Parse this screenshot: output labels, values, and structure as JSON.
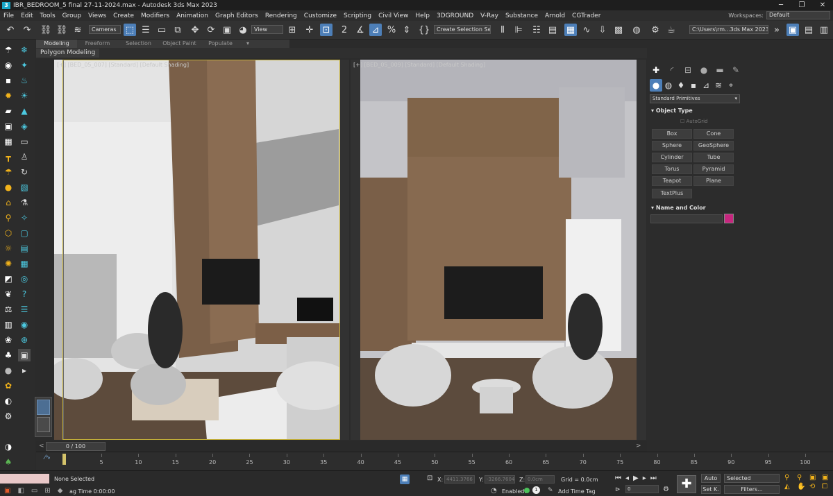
{
  "window": {
    "title": "IBR_BEDROOM_5 final 27-11-2024.max - Autodesk 3ds Max 2023",
    "controls": [
      "─",
      "❐",
      "✕"
    ]
  },
  "menu": {
    "items": [
      "File",
      "Edit",
      "Tools",
      "Group",
      "Views",
      "Create",
      "Modifiers",
      "Animation",
      "Graph Editors",
      "Rendering",
      "Customize",
      "Scripting",
      "Civil View",
      "Help",
      "3DGROUND",
      "V-Ray",
      "Substance",
      "Arnold",
      "CGTrader"
    ],
    "workspaces_label": "Workspaces:",
    "workspaces_value": "Default"
  },
  "toolbar": {
    "cameras_dropdown": "Cameras",
    "view_dropdown": "View",
    "selection_set": "Create Selection Set",
    "path_dropdown": "C:\\Users\\rm...3ds Max 2023"
  },
  "ribbon": {
    "tabs": [
      "Modeling",
      "Freeform",
      "Selection",
      "Object Paint",
      "Populate"
    ],
    "active_tab": "Modeling",
    "subpanel": "Polygon Modeling"
  },
  "viewports": {
    "left_label": "[+] [BED_05_007] [Standard] [Default Shading]",
    "right_label": "[+] [BED_05_009] [Standard] [Default Shading]"
  },
  "command_panel": {
    "category_dropdown": "Standard Primitives",
    "object_type_header": "Object Type",
    "autogrid": "AutoGrid",
    "buttons": [
      "Box",
      "Cone",
      "Sphere",
      "GeoSphere",
      "Cylinder",
      "Tube",
      "Torus",
      "Pyramid",
      "Teapot",
      "Plane",
      "TextPlus"
    ],
    "name_color_header": "Name and Color",
    "color_swatch": "#c7267f"
  },
  "timeline": {
    "frame_display": "0 / 100",
    "ticks": [
      "5",
      "10",
      "15",
      "20",
      "25",
      "30",
      "35",
      "40",
      "45",
      "50",
      "55",
      "60",
      "65",
      "70",
      "75",
      "80",
      "85",
      "90",
      "95",
      "100"
    ]
  },
  "status": {
    "selection": "None Selected",
    "ag_time": "ag Time  0:00:00",
    "x_label": "X:",
    "x_value": "4411.3766",
    "y_label": "Y:",
    "y_value": "-3266.7604",
    "z_label": "Z:",
    "z_value": "0.0cm",
    "grid": "Grid = 0.0cm",
    "enabled_label": "Enabled:",
    "add_time_tag": "Add Time Tag",
    "auto_btn": "Auto",
    "setk_btn": "Set K.",
    "selected_dropdown": "Selected",
    "filters_btn": "Filters...",
    "frame_field": "0"
  }
}
